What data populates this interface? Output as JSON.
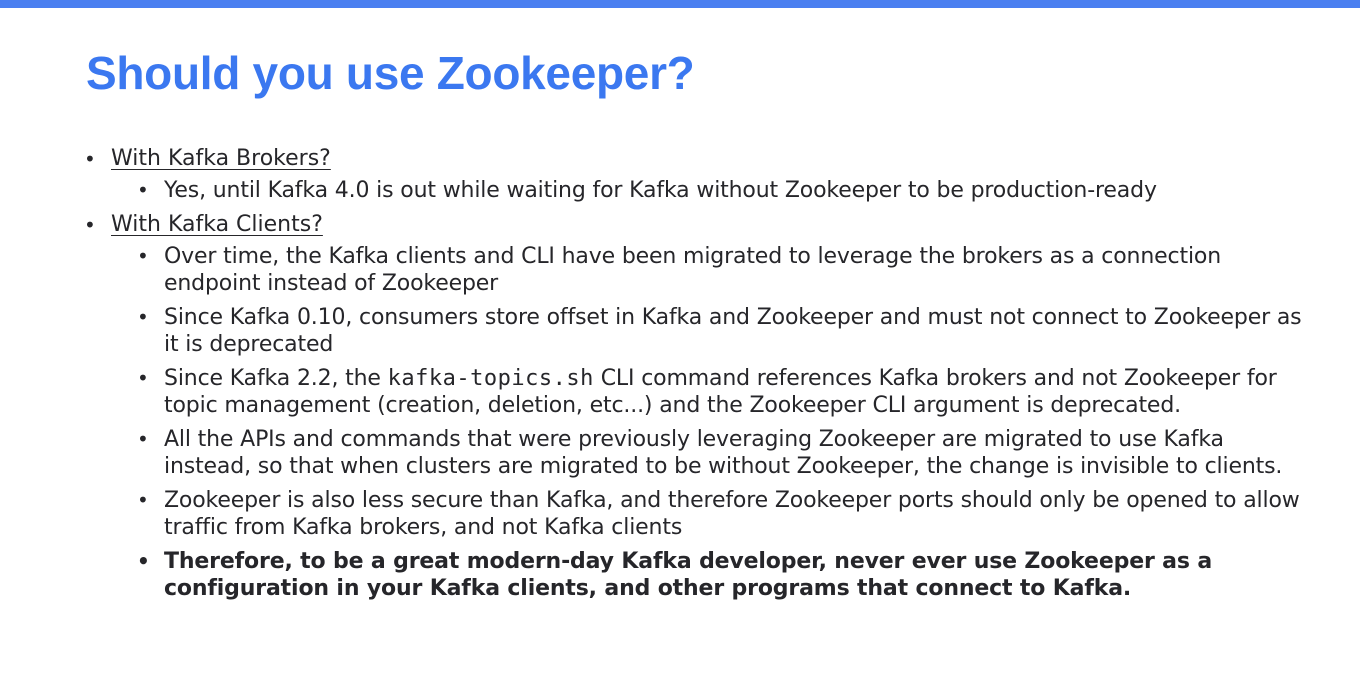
{
  "slide": {
    "title": "Should you use Zookeeper?",
    "sections": [
      {
        "question": "With Kafka Brokers?",
        "points": [
          "Yes, until Kafka 4.0 is out while waiting for Kafka without Zookeeper to be production-ready"
        ]
      },
      {
        "question": "With Kafka Clients?",
        "points": [
          "Over time, the Kafka clients and CLI have been migrated to leverage the brokers as a connection endpoint instead of Zookeeper",
          "Since Kafka 0.10, consumers store offset in Kafka and Zookeeper and must not connect to Zookeeper as it is deprecated",
          {
            "before": "Since Kafka 2.2, the ",
            "code": "kafka-topics.sh",
            "after": " CLI command references Kafka brokers and not Zookeeper for topic management (creation, deletion, etc...) and the Zookeeper CLI argument is deprecated."
          },
          "All the APIs and commands that were previously leveraging Zookeeper are migrated to use Kafka instead, so that when clusters are migrated to be without Zookeeper, the change is invisible to clients.",
          "Zookeeper is also less secure than Kafka, and therefore Zookeeper ports should only be opened to allow traffic from Kafka brokers, and not Kafka clients",
          "Therefore, to be a great modern-day Kafka developer, never ever use Zookeeper as a configuration in your Kafka clients, and other programs that connect to Kafka."
        ]
      }
    ]
  },
  "colors": {
    "accent": "#3b78f0",
    "top_bar": "#4a7ff0",
    "text": "#26262a"
  }
}
